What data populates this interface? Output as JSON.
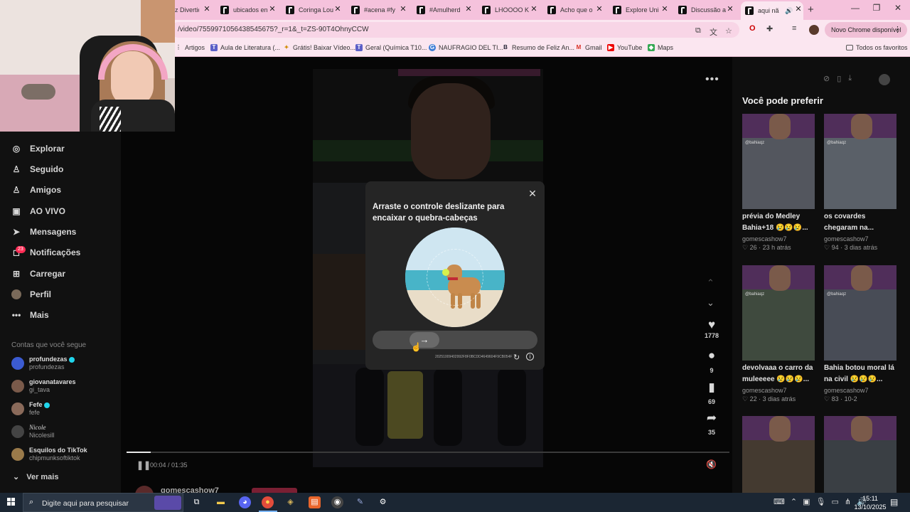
{
  "browser": {
    "tabs": [
      {
        "label": "z Divertid"
      },
      {
        "label": "ubicados en"
      },
      {
        "label": "Coringa Lou"
      },
      {
        "label": "#acena #fy"
      },
      {
        "label": "#Amulherd"
      },
      {
        "label": "LHOOOO K"
      },
      {
        "label": "Acho que o"
      },
      {
        "label": "Explore Uni"
      },
      {
        "label": "Discussão a"
      },
      {
        "label": "aqui nã",
        "active": true
      }
    ],
    "new_tab": "+",
    "window_controls": [
      "—",
      "❐",
      "✕"
    ],
    "url": "/video/7559971056438545675?_r=1&_t=ZS-90T4OhnyCCW",
    "update_chip": "Novo Chrome disponível",
    "bookmarks": [
      {
        "label": "Artigos",
        "icon": "apps-icon"
      },
      {
        "label": "Aula de Literatura (...",
        "icon": "teams-icon"
      },
      {
        "label": "Grátis! Baixar Vídeo...",
        "icon": "download-icon"
      },
      {
        "label": "Geral (Química T10...",
        "icon": "teams-icon"
      },
      {
        "label": "NAUFRAGIO DEL TI...",
        "icon": "globe-icon"
      },
      {
        "label": "Resumo de Feliz An...",
        "icon": "b-icon"
      },
      {
        "label": "Gmail",
        "icon": "gmail-icon"
      },
      {
        "label": "YouTube",
        "icon": "youtube-icon"
      },
      {
        "label": "Maps",
        "icon": "maps-icon"
      }
    ],
    "all_bookmarks": "Todos os favoritos"
  },
  "sidebar": {
    "items": [
      {
        "label": "Explorar",
        "icon": "compass-icon"
      },
      {
        "label": "Seguido",
        "icon": "user-icon"
      },
      {
        "label": "Amigos",
        "icon": "users-icon"
      },
      {
        "label": "AO VIVO",
        "icon": "live-icon"
      },
      {
        "label": "Mensagens",
        "icon": "message-icon"
      },
      {
        "label": "Notificações",
        "icon": "bell-icon"
      },
      {
        "label": "Carregar",
        "icon": "plus-icon"
      },
      {
        "label": "Perfil",
        "icon": "avatar-icon"
      },
      {
        "label": "Mais",
        "icon": "dots-icon"
      }
    ],
    "notif_badge": "23",
    "following_title": "Contas que você segue",
    "accounts": [
      {
        "display": "profundezas",
        "user": "profundezas",
        "verified": true,
        "color": "#3b5bd1"
      },
      {
        "display": "giovanatavares",
        "user": "gi_tava",
        "verified": false,
        "color": "#7a5a4a"
      },
      {
        "display": "Fefe",
        "user": "fefe",
        "verified": true,
        "color": "#8a6a5a"
      },
      {
        "display": "Nicole",
        "user": "Nicolesill",
        "verified": false,
        "color": "#444"
      },
      {
        "display": "Esquilos do TikTok",
        "user": "chipmunksoftiktok",
        "verified": false,
        "color": "#9a7a4a"
      }
    ],
    "see_more": "Ver mais"
  },
  "video": {
    "likes": "1778",
    "comments": "9",
    "saves": "69",
    "shares": "35",
    "time": "00:04 / 01:35",
    "progress": 0.04,
    "author": "gomescashow7"
  },
  "captcha": {
    "title": "Arraste o controle deslizante para encaixar o quebra-cabeças",
    "code": "20251009402992F8F0BCDD4649604F9CB054F",
    "close": "✕",
    "handle": "→"
  },
  "recommendations": {
    "title": "Você pode preferir",
    "items": [
      {
        "title": "prévia do Medley Bahia+18 😢😢😢...",
        "author": "gomescashow7",
        "meta": "♡ 26 · 23 h atrás"
      },
      {
        "title": "os covardes chegaram na...",
        "author": "gomescashow7",
        "meta": "♡ 94 · 3 dias atrás"
      },
      {
        "title": "devolvaaa o carro da muleeeee 😢😢😢...",
        "author": "gomescashow7",
        "meta": "♡ 22 · 3 dias atrás"
      },
      {
        "title": "Bahia botou moral lá na civil 😢😢😢...",
        "author": "gomescashow7",
        "meta": "♡ 83 · 10-2"
      }
    ],
    "thumb_tag": "@bahiaqz"
  },
  "taskbar": {
    "search_placeholder": "Digite aqui para pesquisar",
    "time": "15:11",
    "date": "13/10/2025"
  }
}
